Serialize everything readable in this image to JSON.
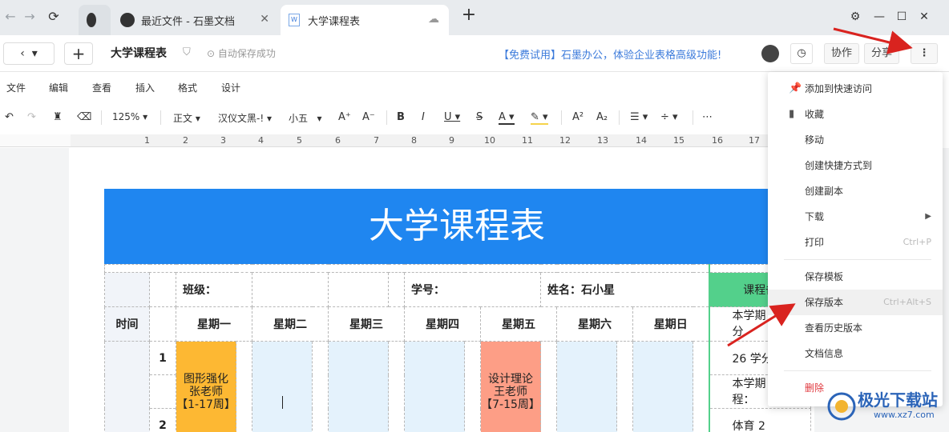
{
  "browser": {
    "tabs": [
      {
        "label": "最近文件 - 石墨文档"
      },
      {
        "label": "大学课程表"
      }
    ],
    "new_tab": "+"
  },
  "docbar": {
    "title": "大学课程表",
    "autosave": "自动保存成功",
    "promo": "【免费试用】石墨办公，体验企业表格高级功能!",
    "collab": "协作",
    "share": "分享"
  },
  "menubar": [
    "文件",
    "编辑",
    "查看",
    "插入",
    "格式",
    "设计"
  ],
  "format": {
    "zoom": "125%",
    "style": "正文",
    "font": "汉仪文黑-!",
    "size": "小五"
  },
  "ruler": [
    "1",
    "2",
    "3",
    "4",
    "5",
    "6",
    "7",
    "8",
    "9",
    "10",
    "11",
    "12",
    "13",
    "14",
    "15",
    "16",
    "17"
  ],
  "doc": {
    "banner_title": "大学课程表",
    "class_label": "班级：",
    "id_label": "学号：",
    "name_label": "姓名：石小星",
    "notes_header": "课程备",
    "time_label": "时间",
    "days": [
      "星期一",
      "星期二",
      "星期三",
      "星期四",
      "星期五",
      "星期六",
      "星期日"
    ],
    "periods": [
      "1",
      "2"
    ],
    "course_mon": "图形强化\n张老师\n【1-17周】",
    "course_fri": "设计理论\n王老师\n【7-15周】",
    "notes": [
      "本学期",
      "分",
      "26 学分",
      "本学期",
      "程：",
      "体育 2"
    ]
  },
  "menu": {
    "items": [
      {
        "label": "添加到快速访问",
        "icon": "pin-icon",
        "shortcut": ""
      },
      {
        "label": "收藏",
        "icon": "bookmark-icon",
        "shortcut": ""
      },
      {
        "label": "移动",
        "icon": "",
        "shortcut": ""
      },
      {
        "label": "创建快捷方式到",
        "icon": "",
        "shortcut": ""
      },
      {
        "label": "创建副本",
        "icon": "",
        "shortcut": ""
      },
      {
        "label": "下载",
        "icon": "",
        "shortcut": ""
      },
      {
        "label": "打印",
        "icon": "",
        "shortcut": "Ctrl+P"
      },
      {
        "label": "保存模板",
        "icon": "",
        "shortcut": ""
      },
      {
        "label": "保存版本",
        "icon": "",
        "shortcut": "Ctrl+Alt+S"
      },
      {
        "label": "查看历史版本",
        "icon": "",
        "shortcut": ""
      },
      {
        "label": "文档信息",
        "icon": "",
        "shortcut": ""
      },
      {
        "label": "删除",
        "icon": "",
        "shortcut": ""
      }
    ]
  },
  "watermark": {
    "title": "极光下载站",
    "url": "www.xz7.com"
  },
  "colors": {
    "banner": "#1f86f0",
    "course_orange": "#fdb833",
    "course_salmon": "#fd9e86",
    "notes_green": "#53d08b",
    "arrow": "#d9231f"
  }
}
